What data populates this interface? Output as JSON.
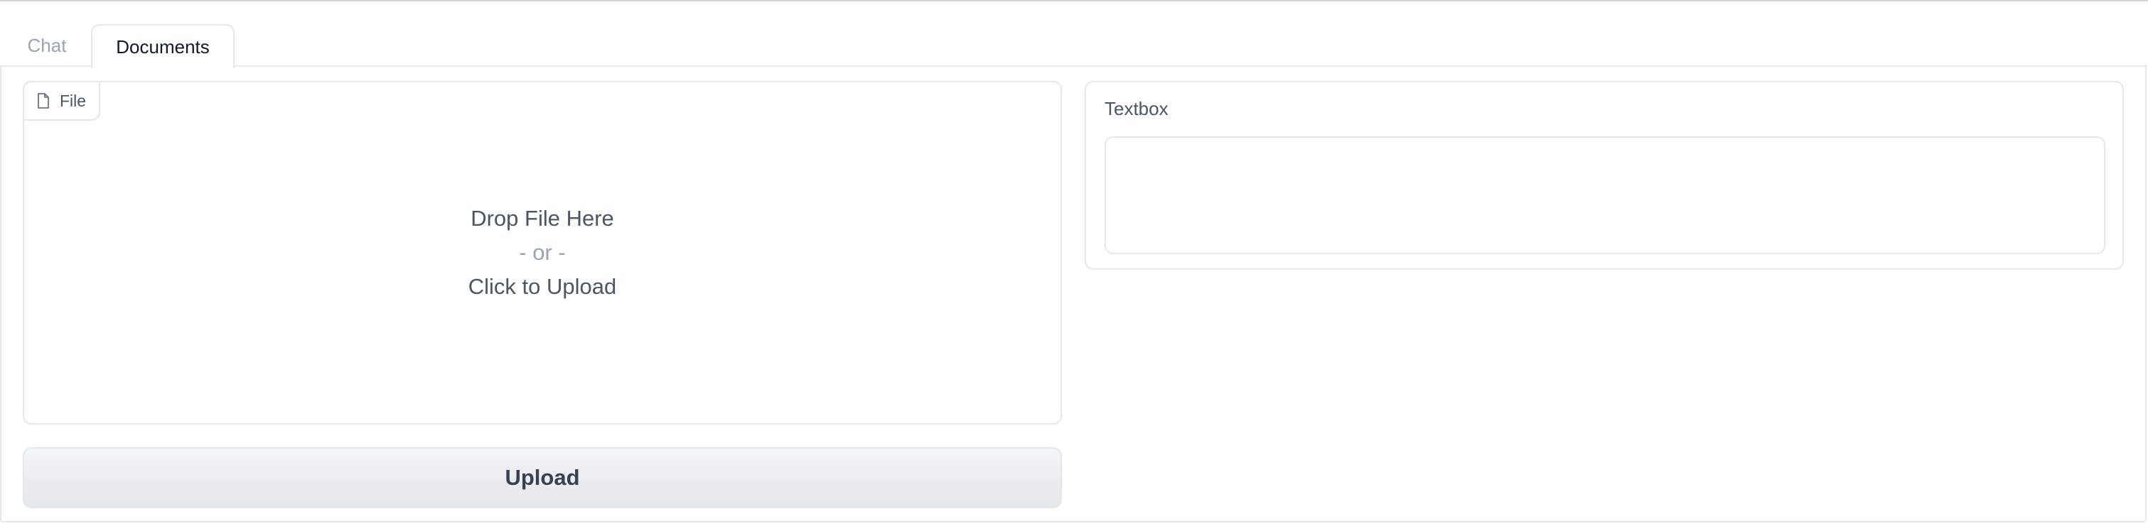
{
  "tabs": [
    {
      "label": "Chat",
      "active": false
    },
    {
      "label": "Documents",
      "active": true
    }
  ],
  "file_upload": {
    "label": "File",
    "icon": "file-icon",
    "drop_text": "Drop File Here",
    "or_text": "- or -",
    "click_text": "Click to Upload"
  },
  "upload_button": {
    "label": "Upload"
  },
  "textbox": {
    "label": "Textbox",
    "value": "",
    "placeholder": ""
  },
  "colors": {
    "border": "#e5e7eb",
    "text_muted": "#9ca3af",
    "text": "#4b5563",
    "button_bg": "#eceef1"
  }
}
